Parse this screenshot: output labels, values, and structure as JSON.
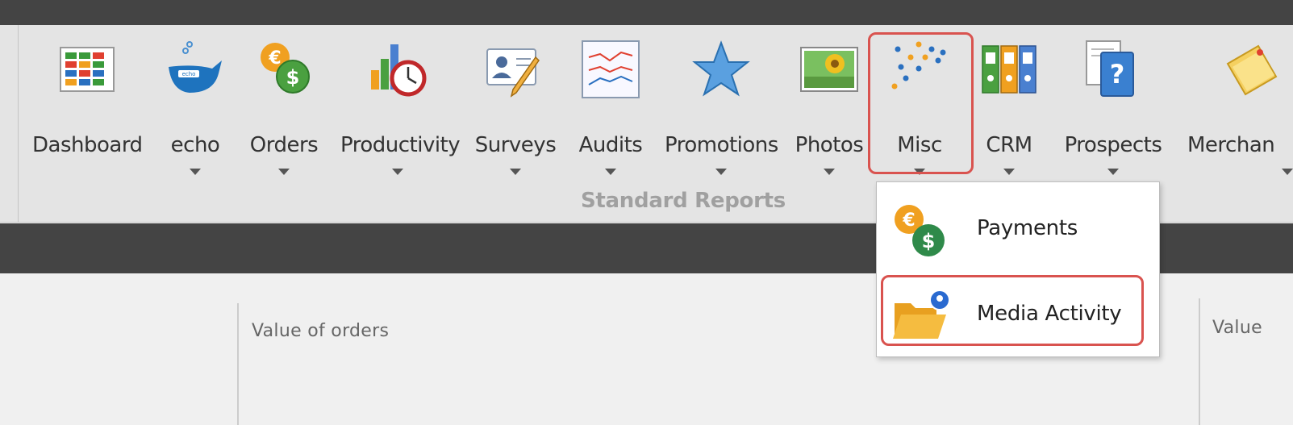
{
  "ribbon": {
    "group_label": "Standard Reports",
    "buttons": [
      {
        "label": "Dashboard",
        "icon": "dashboard-grid-icon",
        "has_dropdown": false
      },
      {
        "label": "echo",
        "icon": "whale-icon",
        "has_dropdown": true
      },
      {
        "label": "Orders",
        "icon": "currency-coins-icon",
        "has_dropdown": true
      },
      {
        "label": "Productivity",
        "icon": "chart-clock-icon",
        "has_dropdown": true
      },
      {
        "label": "Surveys",
        "icon": "id-card-pencil-icon",
        "has_dropdown": true
      },
      {
        "label": "Audits",
        "icon": "line-chart-icon",
        "has_dropdown": true
      },
      {
        "label": "Promotions",
        "icon": "star-icon",
        "has_dropdown": true
      },
      {
        "label": "Photos",
        "icon": "photo-icon",
        "has_dropdown": true
      },
      {
        "label": "Misc",
        "icon": "scatter-dots-icon",
        "has_dropdown": true
      },
      {
        "label": "CRM",
        "icon": "binders-icon",
        "has_dropdown": true
      },
      {
        "label": "Prospects",
        "icon": "question-document-icon",
        "has_dropdown": true
      },
      {
        "label": "Merchan",
        "icon": "sticky-notes-icon",
        "has_dropdown": true
      }
    ]
  },
  "misc_menu": {
    "items": [
      {
        "label": "Payments",
        "icon": "currency-coins-icon"
      },
      {
        "label": "Media Activity",
        "icon": "folder-pin-icon"
      }
    ]
  },
  "content": {
    "panel_titles": [
      "Value of orders",
      "Value"
    ]
  },
  "colors": {
    "highlight": "#d9534f",
    "dark_bar": "#444444",
    "ribbon_bg": "#e4e4e4"
  }
}
